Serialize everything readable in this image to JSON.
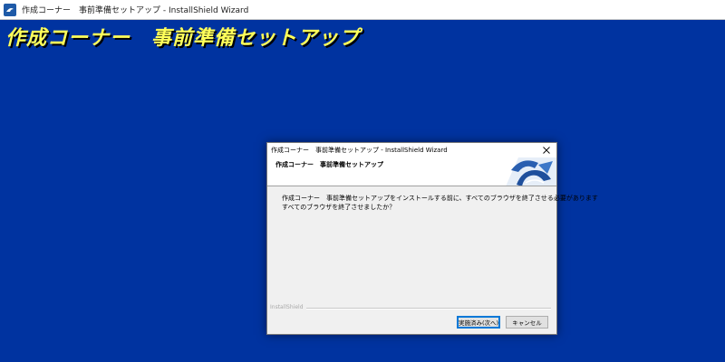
{
  "window": {
    "title": "作成コーナー　事前準備セットアップ - InstallShield Wizard"
  },
  "banner": {
    "text": "作成コーナー　事前準備セットアップ",
    "color": "#ffff5a"
  },
  "background_color": "#0033a0",
  "dialog": {
    "title": "作成コーナー　事前準備セットアップ - InstallShield Wizard",
    "header_title": "作成コーナー　事前準備セットアップ",
    "message_line1": "作成コーナー　事前準備セットアップをインストールする前に、すべてのブラウザを終了させる必要があります",
    "message_line2": "すべてのブラウザを終了させましたか？",
    "brand": "InstallShield",
    "buttons": {
      "next": "実施済み(次へ)",
      "cancel": "キャンセル"
    },
    "icons": {
      "close": "close-icon",
      "logo": "installshield-logo-icon"
    }
  }
}
